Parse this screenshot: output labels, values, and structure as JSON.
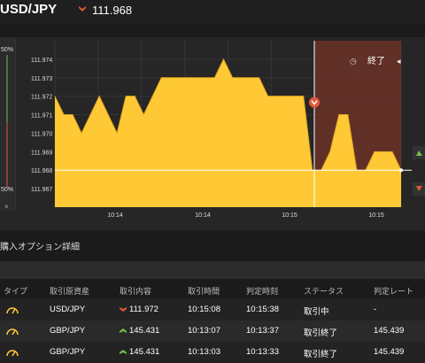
{
  "header": {
    "pair": "USD/JPY",
    "rate": "111.968",
    "rate_direction": "down"
  },
  "chart": {
    "left_panel": {
      "top_label": "50%",
      "bottom_label": "50%",
      "close_label": "×"
    },
    "y_ticks": [
      "111.974",
      "111.973",
      "111.972",
      "111.971",
      "111.970",
      "111.969",
      "111.968",
      "111.967"
    ],
    "x_ticks": [
      "10:14",
      "10:14",
      "10:15",
      "10:15"
    ],
    "end_label": "終了",
    "colors": {
      "area": "#ffc936",
      "zone": "#6b3328",
      "up": "#6fbf4a",
      "down": "#e05a3a"
    }
  },
  "chart_data": {
    "type": "area",
    "x": [
      0,
      1,
      2,
      3,
      4,
      5,
      6,
      7,
      8,
      9,
      10,
      11,
      12,
      13,
      14,
      15,
      16,
      17,
      18,
      19,
      20,
      21,
      22,
      23,
      24,
      25,
      26,
      27,
      28,
      29,
      30,
      31,
      32,
      33,
      34,
      35,
      36,
      37,
      38,
      39
    ],
    "values": [
      111.972,
      111.971,
      111.971,
      111.97,
      111.971,
      111.972,
      111.971,
      111.97,
      111.972,
      111.972,
      111.971,
      111.972,
      111.973,
      111.973,
      111.973,
      111.973,
      111.973,
      111.973,
      111.973,
      111.974,
      111.973,
      111.973,
      111.973,
      111.973,
      111.972,
      111.972,
      111.972,
      111.972,
      111.972,
      111.968,
      111.968,
      111.969,
      111.971,
      111.971,
      111.968,
      111.968,
      111.969,
      111.969,
      111.969,
      111.968
    ],
    "ylim": [
      111.966,
      111.975
    ],
    "ylabel": "",
    "xlabel": ""
  },
  "section": {
    "title": "購入オプション詳細"
  },
  "table": {
    "columns": [
      "タイプ",
      "取引原資産",
      "取引内容",
      "取引時間",
      "判定時刻",
      "ステータス",
      "判定レート"
    ],
    "rows": [
      {
        "pair": "USD/JPY",
        "direction": "down",
        "rate": "111.972",
        "time": "10:15:08",
        "judge": "10:15:38",
        "status": "取引中",
        "result": "-"
      },
      {
        "pair": "GBP/JPY",
        "direction": "up",
        "rate": "145.431",
        "time": "10:13:07",
        "judge": "10:13:37",
        "status": "取引終了",
        "result": "145.439"
      },
      {
        "pair": "GBP/JPY",
        "direction": "up",
        "rate": "145.431",
        "time": "10:13:03",
        "judge": "10:13:33",
        "status": "取引終了",
        "result": "145.439"
      }
    ]
  }
}
